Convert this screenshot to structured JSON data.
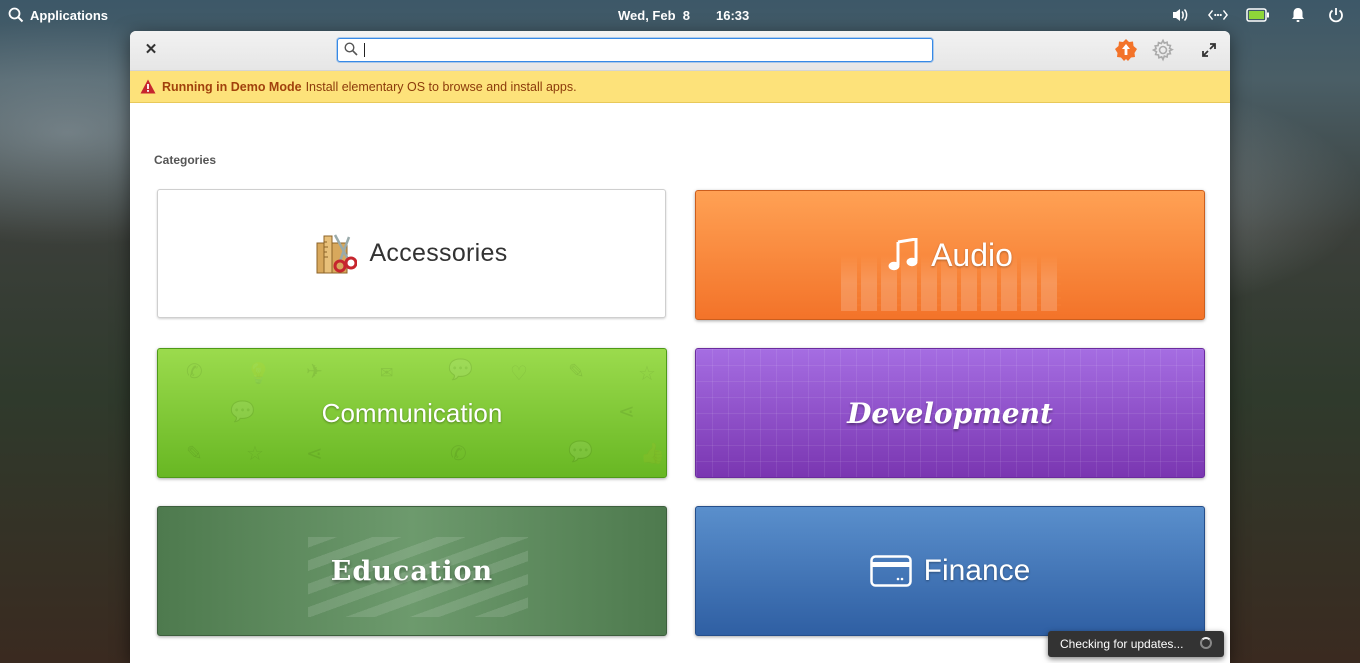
{
  "panel": {
    "apps_label": "Applications",
    "date": "Wed, Feb  8",
    "time": "16:33",
    "tray_icons": [
      "volume-icon",
      "network-icon",
      "battery-icon",
      "notifications-icon",
      "power-icon"
    ]
  },
  "titlebar": {
    "close_glyph": "✕",
    "search_value": "",
    "search_placeholder": ""
  },
  "infobar": {
    "title": "Running in Demo Mode",
    "message": "Install elementary OS to browse and install apps."
  },
  "categories": {
    "heading": "Categories",
    "items": [
      {
        "label": "Accessories",
        "color": "#ffffff"
      },
      {
        "label": "Audio",
        "color": "#f37329"
      },
      {
        "label": "Communication",
        "color": "#68b723"
      },
      {
        "label": "Development",
        "color": "#7a36b1"
      },
      {
        "label": "Education",
        "color": "#5a8a5a"
      },
      {
        "label": "Finance",
        "color": "#3a6db3"
      }
    ]
  },
  "toast": {
    "message": "Checking for updates..."
  }
}
